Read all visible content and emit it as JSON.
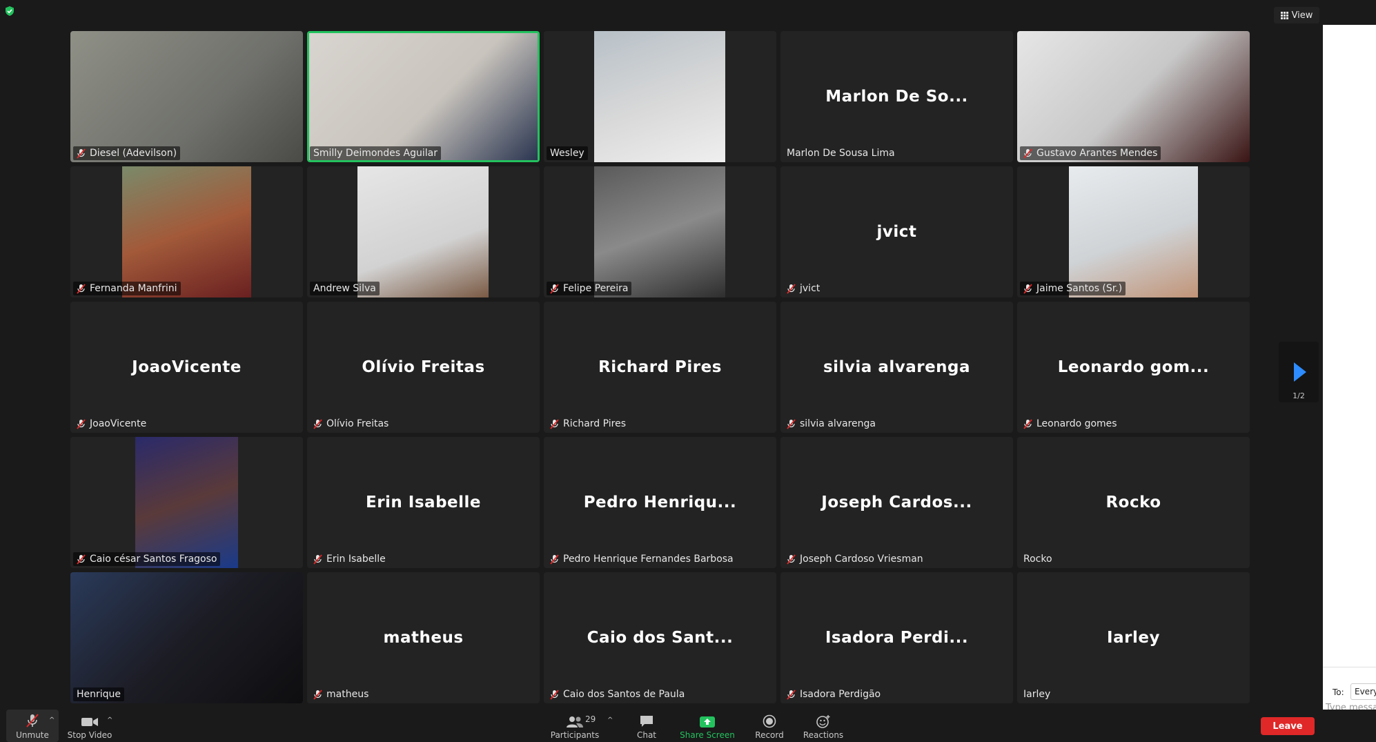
{
  "header": {
    "view_label": "View"
  },
  "colors": {
    "accent_blue": "#2d8cff",
    "active_border": "#23c25e",
    "leave_red": "#e02828",
    "tile_bg": "#232323"
  },
  "participants": [
    {
      "label": "Diesel (Adevilson)",
      "muted": true,
      "video": "photo",
      "active": false,
      "display_name": ""
    },
    {
      "label": "Smilly Deimondes Aguilar",
      "muted": false,
      "video": "photo",
      "active": true,
      "display_name": ""
    },
    {
      "label": "Wesley",
      "muted": false,
      "video": "photo",
      "active": false,
      "display_name": ""
    },
    {
      "label": "Marlon De Sousa Lima",
      "muted": false,
      "video": "none",
      "active": false,
      "display_name": "Marlon De So..."
    },
    {
      "label": "Gustavo Arantes Mendes",
      "muted": true,
      "video": "photo",
      "active": false,
      "display_name": ""
    },
    {
      "label": "Fernanda Manfrini",
      "muted": true,
      "video": "photo",
      "active": false,
      "display_name": ""
    },
    {
      "label": "Andrew Silva",
      "muted": false,
      "video": "photo",
      "active": false,
      "display_name": ""
    },
    {
      "label": "Felipe Pereira",
      "muted": true,
      "video": "photo",
      "active": false,
      "display_name": ""
    },
    {
      "label": "jvict",
      "muted": true,
      "video": "none",
      "active": false,
      "display_name": "jvict"
    },
    {
      "label": "Jaime Santos (Sr.)",
      "muted": true,
      "video": "photo",
      "active": false,
      "display_name": ""
    },
    {
      "label": "JoaoVicente",
      "muted": true,
      "video": "none",
      "active": false,
      "display_name": "JoaoVicente"
    },
    {
      "label": "Olívio Freitas",
      "muted": true,
      "video": "none",
      "active": false,
      "display_name": "Olívio Freitas"
    },
    {
      "label": "Richard Pires",
      "muted": true,
      "video": "none",
      "active": false,
      "display_name": "Richard Pires"
    },
    {
      "label": "silvia alvarenga",
      "muted": true,
      "video": "none",
      "active": false,
      "display_name": "silvia alvarenga"
    },
    {
      "label": "Leonardo gomes",
      "muted": true,
      "video": "none",
      "active": false,
      "display_name": "Leonardo gom..."
    },
    {
      "label": "Caio césar Santos Fragoso",
      "muted": true,
      "video": "photo",
      "active": false,
      "display_name": ""
    },
    {
      "label": "Erin Isabelle",
      "muted": true,
      "video": "none",
      "active": false,
      "display_name": "Erin Isabelle"
    },
    {
      "label": "Pedro Henrique Fernandes Barbosa",
      "muted": true,
      "video": "none",
      "active": false,
      "display_name": "Pedro Henriqu..."
    },
    {
      "label": "Joseph Cardoso Vriesman",
      "muted": true,
      "video": "none",
      "active": false,
      "display_name": "Joseph Cardos..."
    },
    {
      "label": "Rocko",
      "muted": false,
      "video": "none",
      "active": false,
      "display_name": "Rocko"
    },
    {
      "label": "Henrique",
      "muted": false,
      "video": "photo",
      "active": false,
      "display_name": ""
    },
    {
      "label": "matheus",
      "muted": true,
      "video": "none",
      "active": false,
      "display_name": "matheus"
    },
    {
      "label": "Caio dos Santos de Paula",
      "muted": true,
      "video": "none",
      "active": false,
      "display_name": "Caio dos Sant..."
    },
    {
      "label": "Isadora Perdigão",
      "muted": true,
      "video": "none",
      "active": false,
      "display_name": "Isadora Perdi..."
    },
    {
      "label": "Iarley",
      "muted": false,
      "video": "none",
      "active": false,
      "display_name": "Iarley"
    }
  ],
  "pagination": {
    "page_label": "1/2"
  },
  "chat_panel": {
    "to_label": "To:",
    "to_value": "Everyone",
    "message_placeholder": "Type message here..."
  },
  "toolbar": {
    "unmute_label": "Unmute",
    "stop_video_label": "Stop Video",
    "participants_label": "Participants",
    "participants_count": "29",
    "chat_label": "Chat",
    "share_screen_label": "Share Screen",
    "record_label": "Record",
    "reactions_label": "Reactions",
    "leave_label": "Leave"
  }
}
